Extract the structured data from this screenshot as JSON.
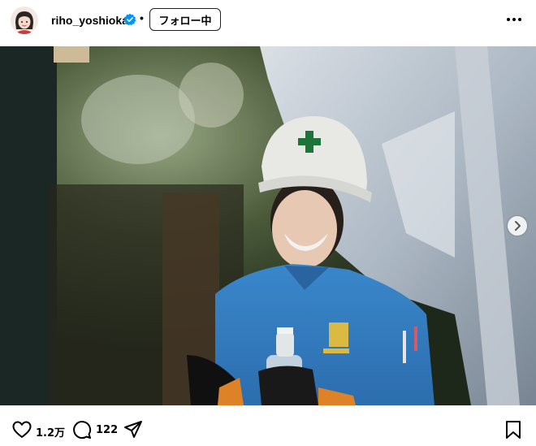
{
  "post": {
    "username": "riho_yoshioka",
    "separator": "•",
    "follow_label": "フォロー中",
    "likes": "1.2万",
    "comments": "122"
  },
  "icons": {
    "verified": "verified-badge-icon",
    "more": "more-options-icon",
    "like": "heart-icon",
    "comment": "comment-icon",
    "share": "share-icon",
    "save": "bookmark-icon",
    "next": "chevron-right-icon"
  },
  "colors": {
    "verified_blue": "#0095f6",
    "text": "#000000"
  }
}
